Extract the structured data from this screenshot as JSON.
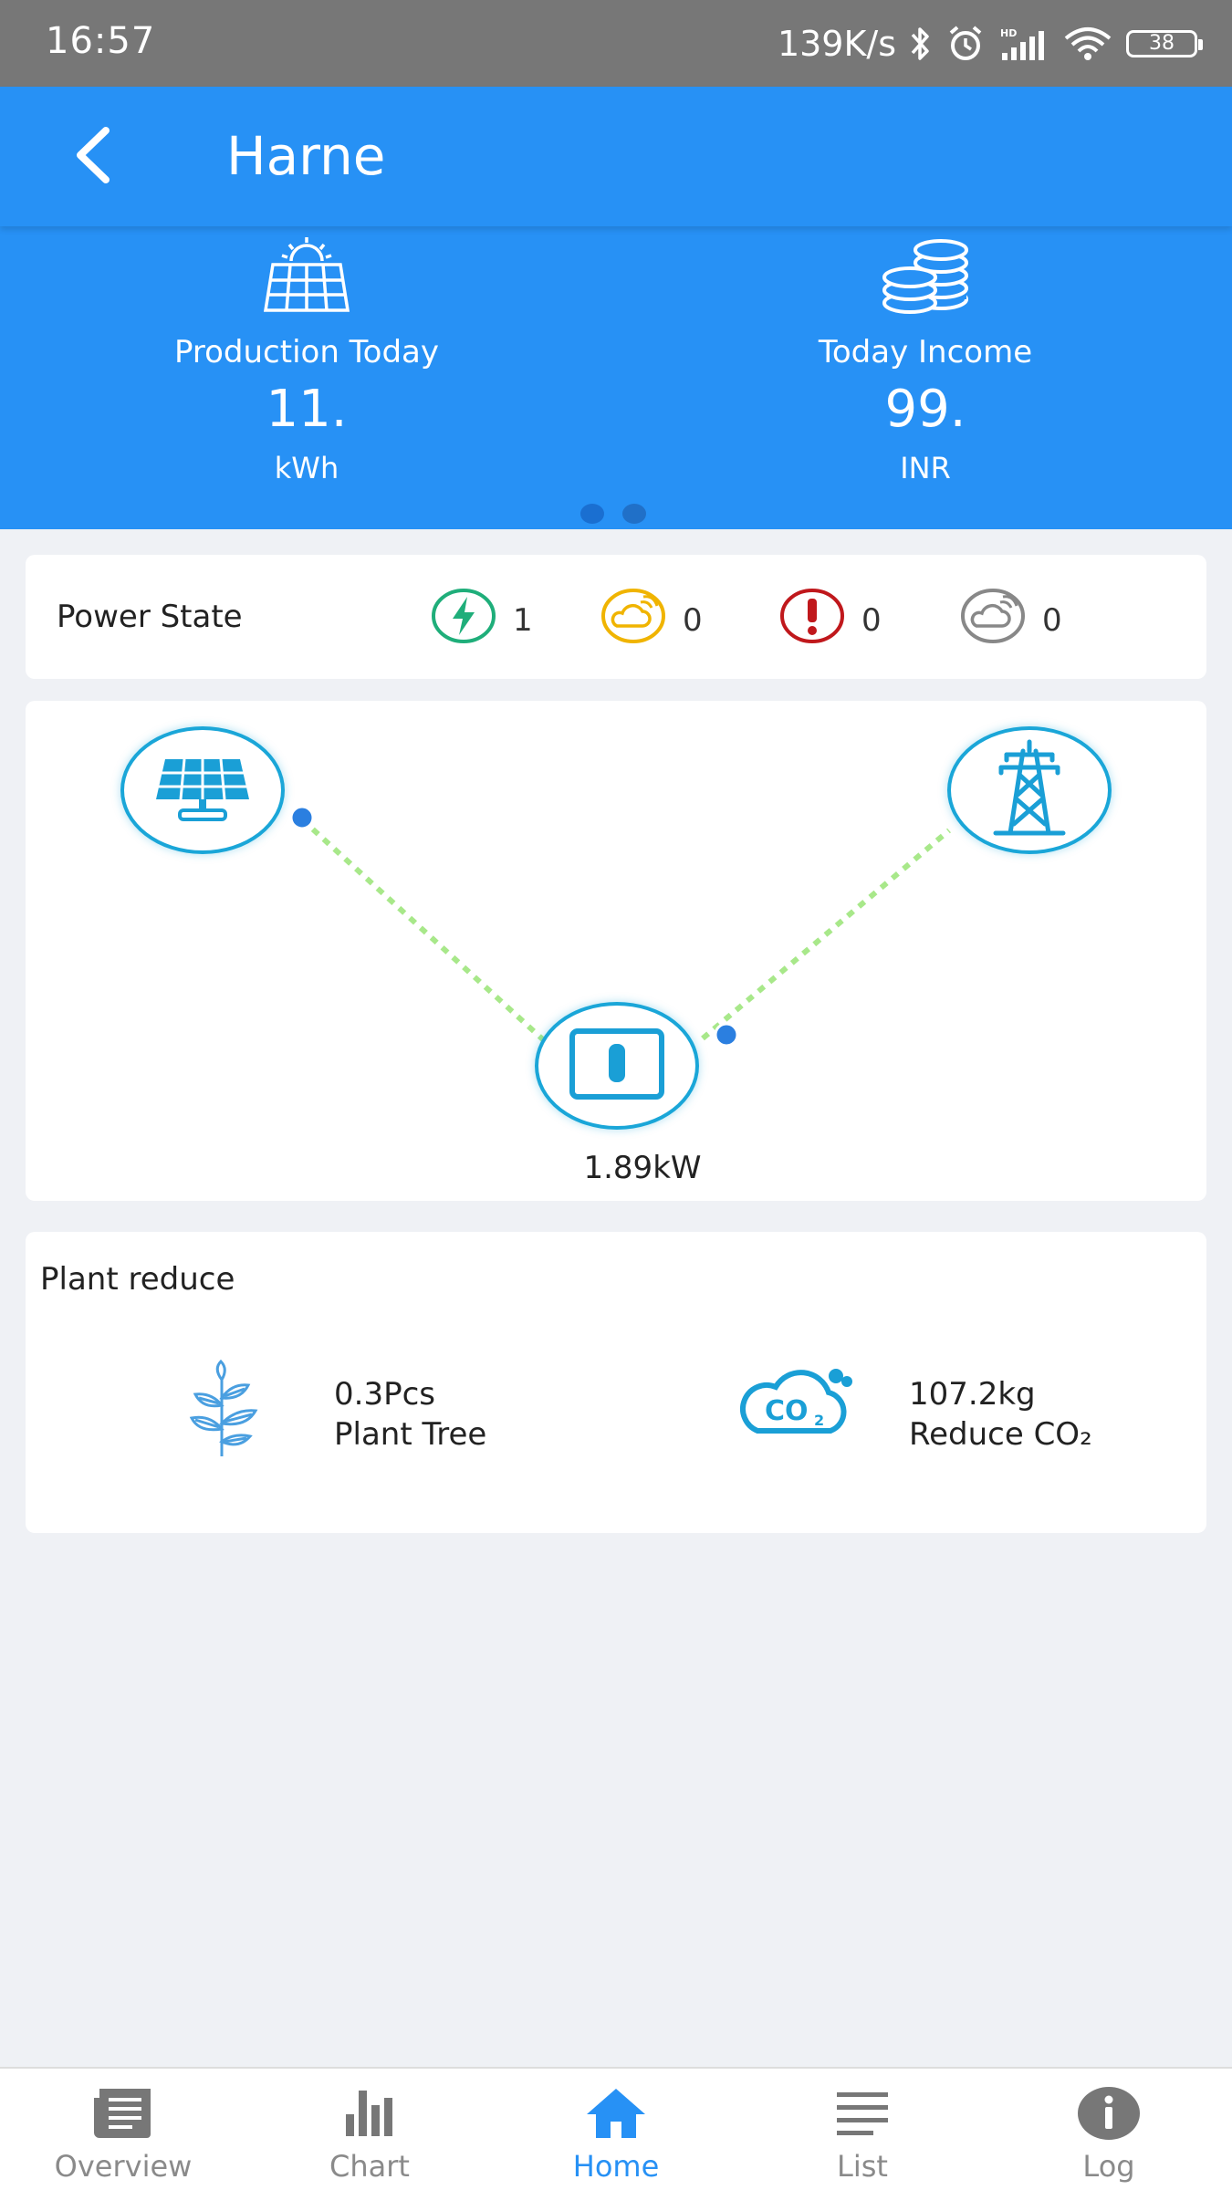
{
  "status_bar": {
    "time": "16:57",
    "network_speed": "139K/s",
    "battery": "38",
    "icons": [
      "bluetooth-icon",
      "alarm-icon",
      "signal-icon",
      "wifi-icon",
      "battery-icon"
    ]
  },
  "header": {
    "title": "Harne",
    "back_icon": "chevron-left-icon"
  },
  "banner": {
    "production": {
      "label": "Production Today",
      "value": "11.",
      "unit": "kWh",
      "icon": "solar-panel-icon"
    },
    "income": {
      "label": "Today Income",
      "value": "99.",
      "unit": "INR",
      "icon": "coins-icon"
    },
    "pages": 2,
    "active_page": 1
  },
  "power_state": {
    "label": "Power State",
    "items": [
      {
        "icon": "normal-bolt-icon",
        "count": "1",
        "color": "#1fae7a"
      },
      {
        "icon": "standby-cloud-icon",
        "count": "0",
        "color": "#f0b400"
      },
      {
        "icon": "fault-alert-icon",
        "count": "0",
        "color": "#c0181c"
      },
      {
        "icon": "offline-cloud-icon",
        "count": "0",
        "color": "#888888"
      }
    ]
  },
  "flow": {
    "nodes": [
      "solar-panel-icon",
      "inverter-icon",
      "grid-tower-icon"
    ],
    "power": "1.89kW",
    "line_color": "#a8e88a",
    "node_color": "#1aa6d8"
  },
  "plant_reduce": {
    "title": "Plant reduce",
    "tree": {
      "value": "0.3Pcs",
      "label": "Plant Tree",
      "icon": "tree-icon"
    },
    "co2": {
      "value": "107.2kg",
      "label": "Reduce CO₂",
      "icon": "co2-cloud-icon"
    }
  },
  "bottom_nav": {
    "items": [
      {
        "label": "Overview",
        "icon": "overview-icon"
      },
      {
        "label": "Chart",
        "icon": "chart-icon"
      },
      {
        "label": "Home",
        "icon": "home-icon"
      },
      {
        "label": "List",
        "icon": "list-icon"
      },
      {
        "label": "Log",
        "icon": "info-icon"
      }
    ],
    "active": "Home"
  },
  "colors": {
    "primary": "#2791f5",
    "background": "#eff1f5",
    "card": "#ffffff"
  }
}
